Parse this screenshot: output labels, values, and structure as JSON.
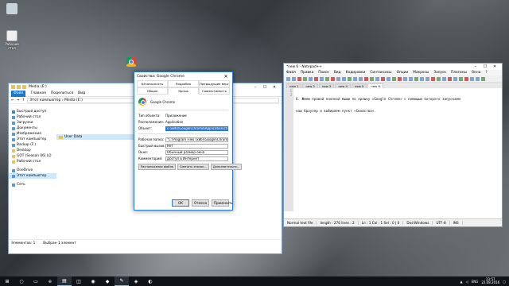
{
  "desktop": {
    "icons": [
      {
        "name": "recycle-bin",
        "label": ""
      },
      {
        "name": "desktop-file",
        "label": "Рабочий стол"
      },
      {
        "name": "chrome",
        "label": ""
      }
    ]
  },
  "explorer": {
    "title": "Media (E:)",
    "tabs": [
      "Файл",
      "Главная",
      "Поделиться",
      "Вид"
    ],
    "address": "Этот компьютер › Media (E:)",
    "nav": [
      {
        "label": "Быстрый доступ",
        "icon": "star"
      },
      {
        "label": "Рабочий стол",
        "icon": "desktop"
      },
      {
        "label": "Загрузки",
        "icon": "download"
      },
      {
        "label": "Документы",
        "icon": "doc"
      },
      {
        "label": "Изображения",
        "icon": "image"
      },
      {
        "label": "Этот компьютер",
        "icon": "pc"
      },
      {
        "label": "Backup (F:)",
        "icon": "drive"
      },
      {
        "label": "Desktop",
        "icon": "folder"
      },
      {
        "label": "GOT (Season 06) LO",
        "icon": "folder"
      },
      {
        "label": "Рабочий стол",
        "icon": "folder"
      },
      {
        "label": "OneDrive",
        "icon": "cloud"
      },
      {
        "label": "Этот компьютер",
        "icon": "pc"
      },
      {
        "label": "Сеть",
        "icon": "network"
      }
    ],
    "files": [
      {
        "name": "User Data"
      }
    ],
    "status": {
      "count": "Элементов: 1",
      "selected": "Выбран 1 элемент"
    }
  },
  "properties": {
    "title": "Свойства: Google Chrome",
    "tabs": [
      "Безопасность",
      "Подробно",
      "Предыдущие версии",
      "Общие",
      "Ярлык",
      "Совместимость"
    ],
    "app_name": "Google Chrome",
    "rows": [
      {
        "label": "Тип объекта:",
        "value": "Приложение"
      },
      {
        "label": "Расположение:",
        "value": "Application"
      }
    ],
    "object_label": "Объект:",
    "object_value": "s (x86)\\Google\\Chrome\\Application\\chrome.exe",
    "fields": [
      {
        "label": "Рабочая папка:",
        "value": "\"C:\\Program Files (x86)\\Google\\Chrome\\Applicatio"
      },
      {
        "label": "Быстрый вызов:",
        "value": "Нет"
      },
      {
        "label": "Окно:",
        "value": "Обычный размер окна"
      },
      {
        "label": "Комментарий:",
        "value": "Доступ в Интернет"
      }
    ],
    "buttons": [
      "Расположение файла",
      "Сменить значок...",
      "Дополнительно..."
    ],
    "ok": "ОК",
    "cancel": "Отмена",
    "apply": "Применить"
  },
  "notepad": {
    "title": "*new 6 - Notepad++",
    "menu": [
      "Файл",
      "Правка",
      "Поиск",
      "Вид",
      "Кодировки",
      "Синтаксисы",
      "Опции",
      "Макросы",
      "Запуск",
      "Плагины",
      "Окна",
      "?"
    ],
    "tabs": [
      "new 1",
      "new 2",
      "new 3",
      "new 4",
      "new 5",
      "new 6"
    ],
    "active_tab": "new 6",
    "lines": [
      "6. Жмем правой кнопкой мыши по ярлыку «Google Chrome» с помощью которого запускаем",
      "наш браузер и выбираем пункт «Свойства»."
    ],
    "line_numbers": [
      "1",
      "2"
    ],
    "status": [
      "Normal text file",
      "length : 276    lines : 2",
      "Ln : 1    Col : 1    Sel : 0 | 0",
      "Dos\\Windows",
      "UTF-8",
      "INS"
    ]
  },
  "taskbar": {
    "lang": "ENG",
    "time": "23:57",
    "date": "22.08.2016"
  }
}
